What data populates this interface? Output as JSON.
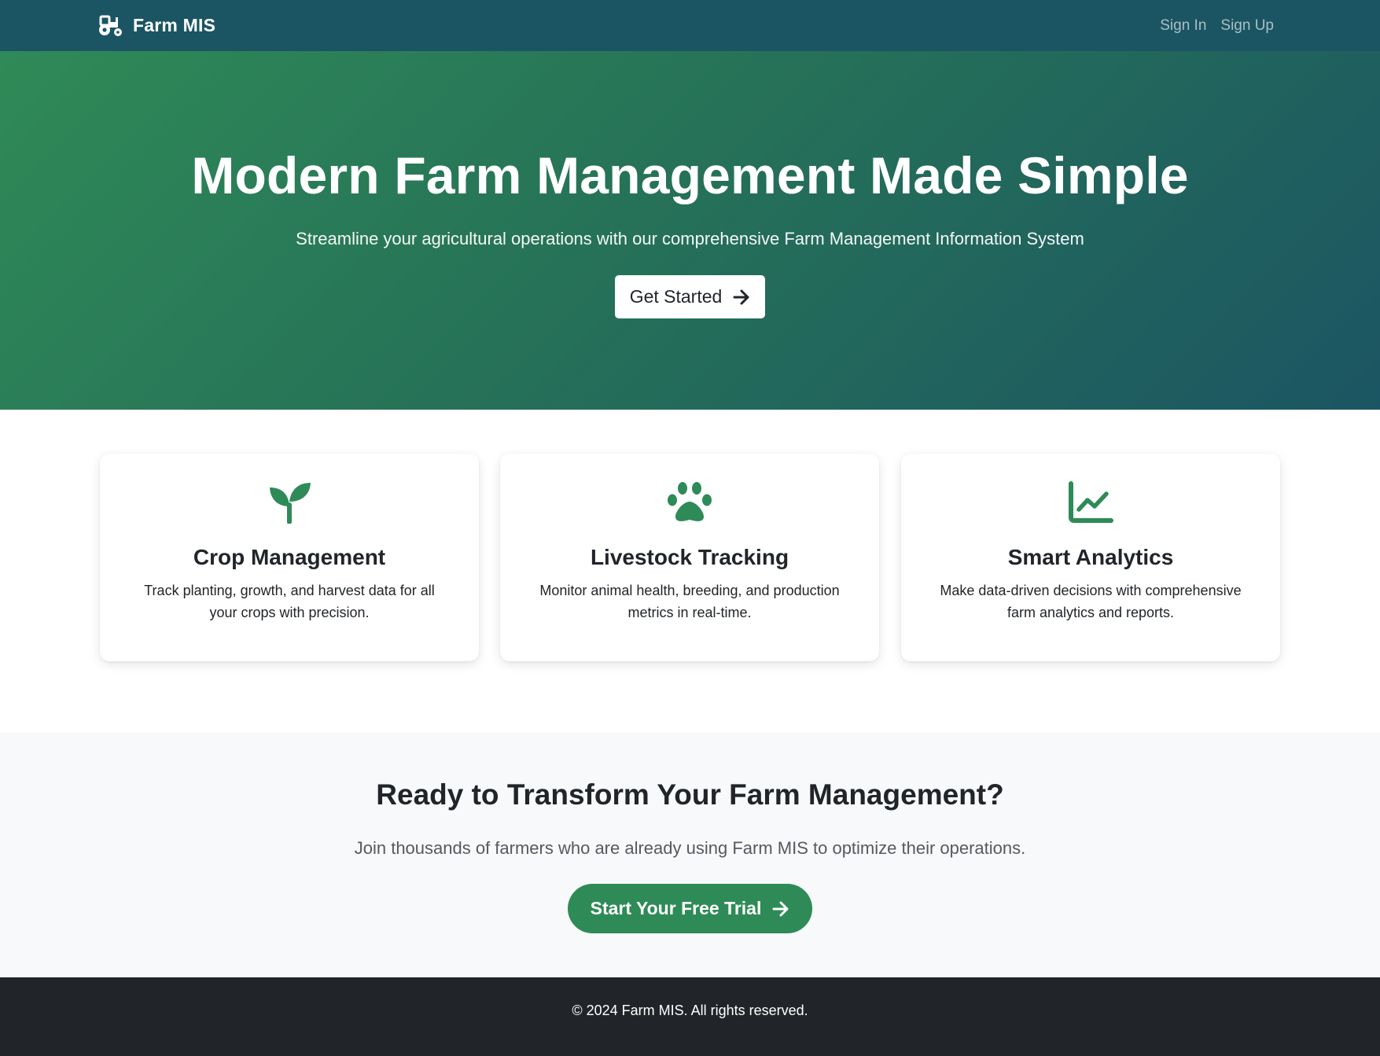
{
  "navbar": {
    "brand_icon": "tractor-icon",
    "brand": "Farm MIS",
    "links": [
      {
        "label": "Sign In"
      },
      {
        "label": "Sign Up"
      }
    ]
  },
  "hero": {
    "title": "Modern Farm Management Made Simple",
    "subtitle": "Streamline your agricultural operations with our comprehensive Farm Management Information System",
    "cta_label": "Get Started",
    "cta_icon": "arrow-right-icon"
  },
  "features": [
    {
      "icon": "seedling-icon",
      "title": "Crop Management",
      "description": "Track planting, growth, and harvest data for all your crops with precision."
    },
    {
      "icon": "paw-icon",
      "title": "Livestock Tracking",
      "description": "Monitor animal health, breeding, and production metrics in real-time."
    },
    {
      "icon": "chart-line-icon",
      "title": "Smart Analytics",
      "description": "Make data-driven decisions with comprehensive farm analytics and reports."
    }
  ],
  "cta": {
    "title": "Ready to Transform Your Farm Management?",
    "subtitle": "Join thousands of farmers who are already using Farm MIS to optimize their operations.",
    "button_label": "Start Your Free Trial",
    "button_icon": "arrow-right-icon"
  },
  "footer": {
    "text": "© 2024 Farm MIS. All rights reserved."
  },
  "colors": {
    "navbar": "#1b5563",
    "accent_green": "#2e8b57",
    "hero_gradient_start": "#2f8a57",
    "hero_gradient_end": "#1b5563",
    "cta_background": "#f8f9fa",
    "footer_background": "#212529"
  }
}
